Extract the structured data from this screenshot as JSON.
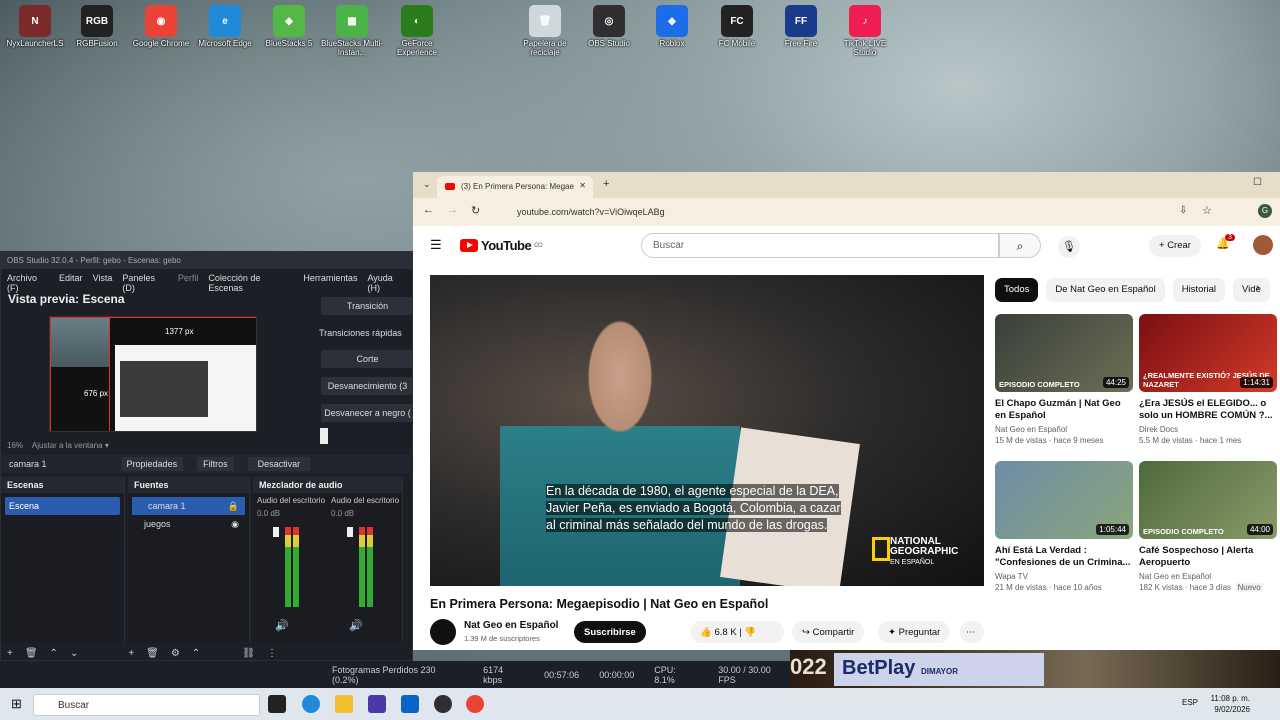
{
  "desktop": {
    "icons": [
      {
        "label": "NyxLauncherLS",
        "color": "#7a2a2a",
        "glyph": "N"
      },
      {
        "label": "RGBFusion",
        "color": "#222",
        "glyph": "RGB"
      },
      {
        "label": "Google Chrome",
        "color": "#ea4335",
        "glyph": "◉"
      },
      {
        "label": "Microsoft Edge",
        "color": "#1f8bd8",
        "glyph": "e"
      },
      {
        "label": "BlueStacks 5",
        "color": "#53b848",
        "glyph": "◆"
      },
      {
        "label": "BlueStacks Multi-Instan...",
        "color": "#4bb348",
        "glyph": "▦"
      },
      {
        "label": "GeForce Experience",
        "color": "#2b7d1c",
        "glyph": "◐"
      },
      {
        "label": "Papelera de reciclaje",
        "color": "#cfd8df",
        "glyph": "🗑"
      },
      {
        "label": "OBS Studio",
        "color": "#302e31",
        "glyph": "◎"
      },
      {
        "label": "Roblox",
        "color": "#1b6ee8",
        "glyph": "◆"
      },
      {
        "label": "FC Mobile",
        "color": "#222",
        "glyph": "FC"
      },
      {
        "label": "Free Fire",
        "color": "#1a3a8a",
        "glyph": "FF"
      },
      {
        "label": "TikTok LIVE Studio",
        "color": "#ee1d52",
        "glyph": "♪"
      }
    ]
  },
  "obs": {
    "title": "OBS Studio 32.0.4 - Perfil: gebo - Escenas: gebo",
    "menu": [
      "Archivo (F)",
      "Editar",
      "Vista",
      "Paneles (D)",
      "Perfil",
      "Colección de Escenas",
      "Herramientas",
      "Ayuda (H)"
    ],
    "preview_title": "Vista previa: Escena",
    "preview_px1": "1377 px",
    "preview_px2": "676 px",
    "transition_buttons": [
      "Transición",
      "Transiciones rápidas",
      "Corte",
      "Desvanecimiento (3",
      "Desvanecer a negro ("
    ],
    "zoom": "16%",
    "zoom_fit": "Ajustar a la ventana",
    "srcbar": {
      "name": "camara 1",
      "props": "Propiedades",
      "filters": "Filtros",
      "deactivate": "Desactivar"
    },
    "scenes": {
      "header": "Escenas",
      "items": [
        "Escena"
      ]
    },
    "sources": {
      "header": "Fuentes",
      "items": [
        "camara 1",
        "juegos"
      ]
    },
    "mixer": {
      "header": "Mezclador de audio",
      "ch1": "Audio del escritorio",
      "ch2": "Audio del escritorio",
      "db1": "0.0 dB",
      "db2": "0.0 dB"
    },
    "status": {
      "dropped": "Fotogramas Perdidos 230 (0.2%)",
      "kbps": "6174 kbps",
      "rec": "00:57:06",
      "time2": "00:00:00",
      "cpu": "CPU: 8.1%",
      "fps": "30.00 / 30.00 FPS"
    }
  },
  "chrome": {
    "tab_title": "(3) En Primera Persona: Megae",
    "url": "youtube.com/watch?v=ViOiwqeLABg",
    "profile": "G"
  },
  "youtube": {
    "logo": "YouTube",
    "logo_sup": "CO",
    "search_placeholder": "Buscar",
    "create": "Crear",
    "notif_count": "3",
    "video_title": "En Primera Persona: Megaepisodio | Nat Geo en Español",
    "subtitle": [
      "En la década de 1980, el agente especial de la DEA,",
      "Javier Peña, es enviado a Bogotá, Colombia, a cazar",
      "al criminal más señalado del mundo de las drogas."
    ],
    "ng_logo": [
      "NATIONAL",
      "GEOGRAPHIC",
      "EN ESPAÑOL"
    ],
    "channel": "Nat Geo en Español",
    "subs": "1.39 M de suscriptores",
    "subscribe": "Suscribirse",
    "likes": "6.8 K",
    "share": "Compartir",
    "ask": "Preguntar",
    "chips": [
      "Todos",
      "De Nat Geo en Español",
      "Historial",
      "Vide"
    ],
    "cards": [
      {
        "title": "El Chapo Guzmán | Nat Geo en Español",
        "channel": "Nat Geo en Español",
        "views": "15 M de vistas · hace 9 meses",
        "dur": "44:25",
        "badge": "EPISODIO COMPLETO",
        "c1": "#3a3f3a",
        "c2": "#6a6f55"
      },
      {
        "title": "¿Era JESÚS el ELEGIDO... o solo un HOMBRE COMÚN ?...",
        "channel": "Direk Docs",
        "views": "5.5 M de vistas · hace 1 mes",
        "dur": "1:14:31",
        "badge": "¿REALMENTE EXISTIÓ? JESÚS DE NAZARET",
        "c1": "#7a0f10",
        "c2": "#d33b2a"
      },
      {
        "title": "Ahí Está La Verdad : \"Confesiones de un Criminа...",
        "channel": "Wapa TV",
        "views": "21 M de vistas · hace 10 años",
        "dur": "1:05:44",
        "badge": "",
        "c1": "#6f8da8",
        "c2": "#8aa57a"
      },
      {
        "title": "Café Sospechoso | Alerta Aeropuerto",
        "channel": "Nat Geo en Español",
        "views": "182 K vistas · hace 3 días",
        "new": "Nuevo",
        "dur": "44:00",
        "badge": "EPISODIO COMPLETO",
        "c1": "#4e6a3a",
        "c2": "#8a9a6a"
      }
    ]
  },
  "banner": {
    "text": "BetPlay",
    "sub": "DIMAYOR",
    "year": "022"
  },
  "taskbar": {
    "search": "Buscar",
    "time": "11:08 p. m.",
    "date": "9/02/2026",
    "lang": "ESP"
  }
}
